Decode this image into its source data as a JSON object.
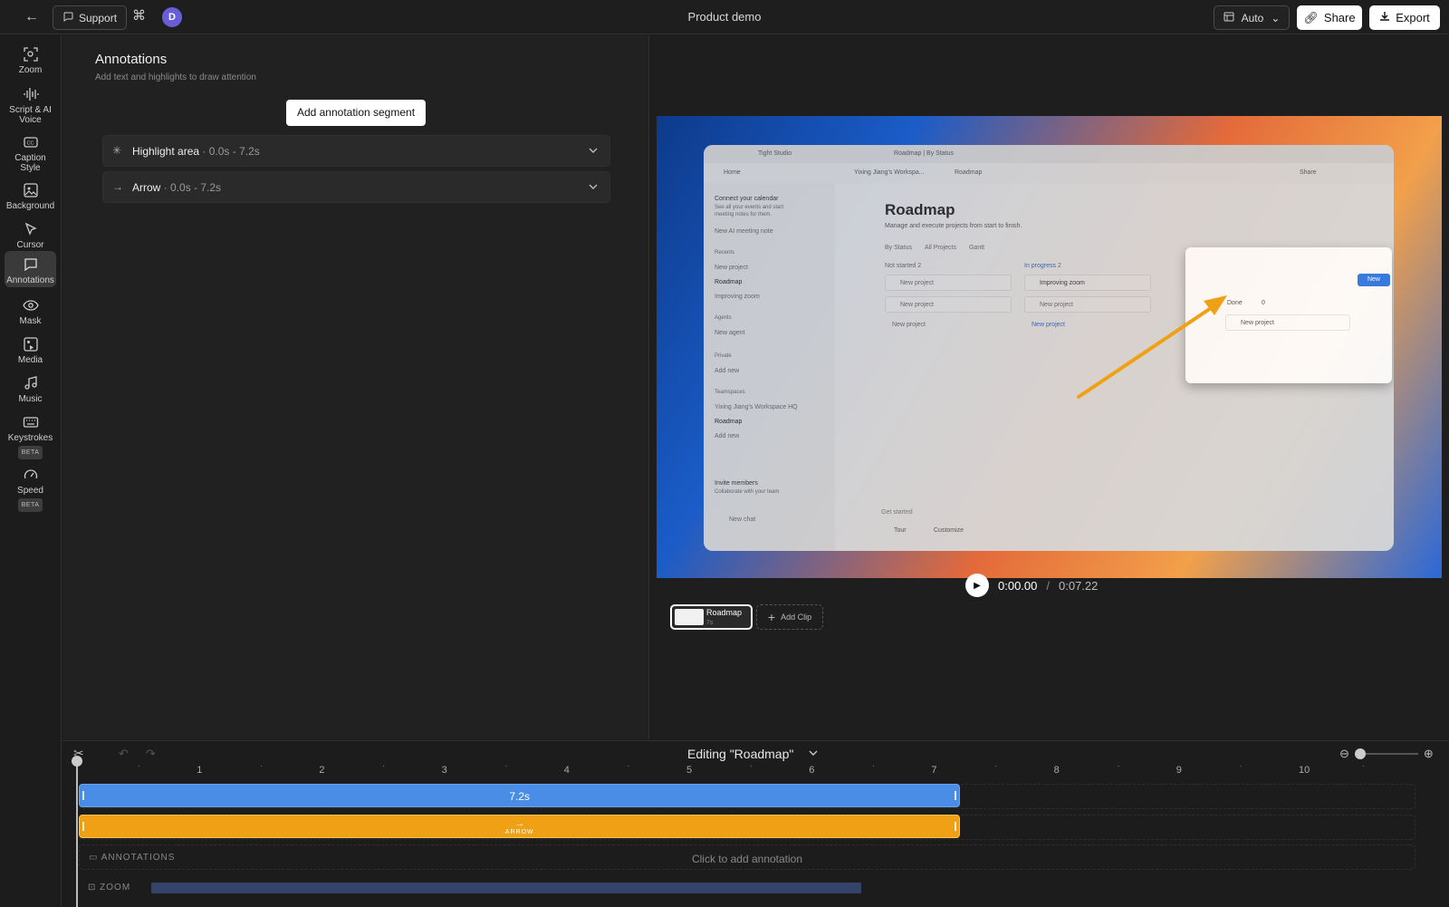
{
  "topbar": {
    "support_label": "Support",
    "avatar_initial": "D",
    "title": "Product demo",
    "auto_label": "Auto",
    "share_label": "Share",
    "export_label": "Export"
  },
  "sidebar": {
    "items": [
      {
        "label": "Zoom",
        "icon": "zoom-icon"
      },
      {
        "label": "Script & AI Voice",
        "icon": "waveform-icon"
      },
      {
        "label": "Caption Style",
        "icon": "caption-icon"
      },
      {
        "label": "Background",
        "icon": "image-icon"
      },
      {
        "label": "Cursor",
        "icon": "cursor-icon"
      },
      {
        "label": "Annotations",
        "icon": "comment-icon"
      },
      {
        "label": "Mask",
        "icon": "eye-icon"
      },
      {
        "label": "Media",
        "icon": "media-icon"
      },
      {
        "label": "Music",
        "icon": "music-icon"
      },
      {
        "label": "Keystrokes",
        "icon": "keyboard-icon",
        "badge": "BETA"
      },
      {
        "label": "Speed",
        "icon": "gauge-icon",
        "badge": "BETA"
      }
    ],
    "active": "Annotations"
  },
  "panel": {
    "title": "Annotations",
    "subtitle": "Add text and highlights to draw attention",
    "add_button": "Add annotation segment",
    "segments": [
      {
        "name": "Highlight area",
        "time": "· 0.0s - 7.2s",
        "icon": "sparkle-icon"
      },
      {
        "name": "Arrow",
        "time": "· 0.0s - 7.2s",
        "icon": "arrow-right-icon"
      }
    ]
  },
  "preview": {
    "app": {
      "tab_title": "Roadmap | By Status",
      "studio": "Tight Studio",
      "breadcrumb_workspace": "Yixing Jiang's Workspa...",
      "breadcrumb_page": "Roadmap",
      "share": "Share",
      "home": "Home",
      "sidebar": {
        "connect": "Connect your calendar",
        "connect_sub": "See all your events and start",
        "connect_sub2": "meeting notes for them.",
        "ai_note": "New AI meeting note",
        "recents": "Recents",
        "recent_items": [
          "New project",
          "Roadmap",
          "Improving zoom"
        ],
        "agents": "Agents",
        "new_agent": "New agent",
        "private": "Private",
        "add_new": "Add new",
        "teamspaces": "Teamspaces",
        "workspace": "Yixing Jiang's Workspace HQ",
        "ts_roadmap": "Roadmap",
        "ts_add": "Add new",
        "invite": "Invite members",
        "invite_sub": "Collaborate with your team",
        "new_chat": "New chat"
      },
      "page_title": "Roadmap",
      "page_subtitle": "Manage and execute projects from start to finish.",
      "tabs": [
        "By Status",
        "All Projects",
        "Gantt"
      ],
      "columns": [
        {
          "name": "Not started",
          "count": "2",
          "cards": [
            "New project",
            "New project"
          ],
          "add": "New project"
        },
        {
          "name": "In progress",
          "count": "2",
          "cards": [
            "Improving zoom",
            "New project"
          ],
          "add": "New project"
        },
        {
          "name": "Done",
          "count": "0",
          "cards": [
            "New project"
          ],
          "add": ""
        }
      ],
      "new_button": "New",
      "get_started": "Get started",
      "tour": "Tour",
      "customize": "Customize"
    },
    "time_current": "0:00.00",
    "time_sep": "/",
    "time_total": "0:07.22",
    "clip_name": "Roadmap",
    "clip_duration": "7s",
    "add_clip": "Add Clip"
  },
  "timeline": {
    "title": "Editing \"Roadmap\"",
    "ruler_labels": [
      "1",
      "2",
      "3",
      "4",
      "5",
      "6",
      "7",
      "8",
      "9",
      "10"
    ],
    "ruler_max": 10.8,
    "clip_length": 7.2,
    "clip_label": "7.2s",
    "arrow_label": "ARROW",
    "annotations_label": "ANNOTATIONS",
    "annotations_hint": "Click to add annotation",
    "zoom_label": "ZOOM",
    "zoom_span": [
      0,
      5.8
    ],
    "colors": {
      "clip": "#4a8de6",
      "arrow": "#f0a014",
      "zoom": "#34436a"
    }
  }
}
